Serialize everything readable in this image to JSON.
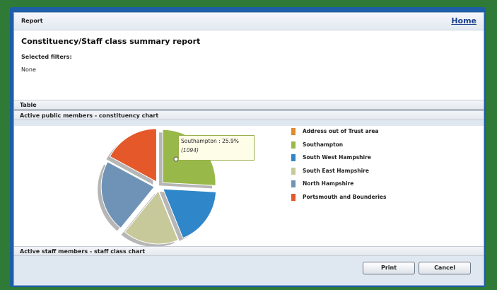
{
  "header": {
    "title": "Report",
    "home_link": "Home"
  },
  "report": {
    "title": "Constituency/Staff class summary report",
    "filters_label": "Selected filters:",
    "filters_value": "None"
  },
  "sections": {
    "table": "Table",
    "public_chart": "Active public members - constituency chart",
    "staff_chart": "Active staff members - staff class chart"
  },
  "tooltip": {
    "label": "Southampton  :  25.9%",
    "count": "(1094)"
  },
  "buttons": {
    "print": "Print",
    "cancel": "Cancel"
  },
  "chart_data": {
    "type": "pie",
    "title": "Active public members - constituency chart",
    "slices": [
      {
        "label": "Address out of Trust area",
        "percent": 0.0,
        "color": "#e08a2c"
      },
      {
        "label": "Southampton",
        "percent": 25.9,
        "count": 1094,
        "color": "#99b84a"
      },
      {
        "label": "South West Hampshire",
        "percent": 18.0,
        "color": "#2f86c8"
      },
      {
        "label": "South East Hampshire",
        "percent": 17.0,
        "color": "#c8c99a"
      },
      {
        "label": "North Hampshire",
        "percent": 22.0,
        "color": "#6e93b6"
      },
      {
        "label": "Portsmouth and Bounderies",
        "percent": 17.1,
        "color": "#e4582a"
      }
    ],
    "legend_position": "right"
  }
}
